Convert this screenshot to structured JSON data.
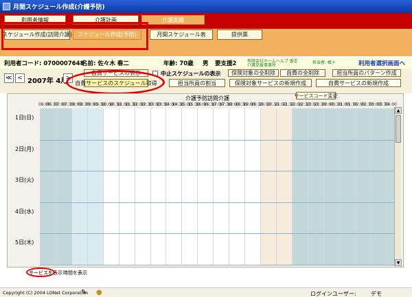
{
  "window": {
    "title": "月間スケジュール作成(介護予防)"
  },
  "top_tabs": [
    "利用者情報",
    "介護計画",
    "介護実績"
  ],
  "sub_tabs": [
    "スケジュール作成(訪問介護)",
    "スケジュール作成(予防)",
    "月間スケジュール表",
    "提供票"
  ],
  "info": {
    "user_code_label": "利用者コード: 0700007648",
    "name_label": "名前: 佐々木 春二",
    "age_label": "年齢: 70歳",
    "gender": "男",
    "care_level": "要支援2",
    "office_line1": "有限会社ホームヘルプ 香芝",
    "office_line2": "介護支援事業所",
    "staff": "担当者: 槙十",
    "select_user_link": "利用者選択画面へ"
  },
  "nav": {
    "prev_prev": "≪",
    "prev": "<",
    "month": "2007年 4月",
    "next": ">",
    "checkbox_label": "中止スケジュールの表示"
  },
  "action_buttons": {
    "row1": [
      "自費サービスの表示",
      "保険対象の全削除",
      "自費の全削除",
      "担当所員のパターン作成"
    ],
    "row2": [
      "自費サービスのスケジュール取得",
      "担当所員の割当",
      "保険対象サービスの新規作成",
      "自費サービスの新規作成"
    ]
  },
  "grid": {
    "title": "介護予防訪問介護",
    "service_code_button": "サービスコード変更",
    "times": [
      "06:00",
      "06:30",
      "07:00",
      "07:30",
      "08:00",
      "08:30",
      "09:00",
      "09:30",
      "10:00",
      "10:30",
      "11:00",
      "11:30",
      "12:00",
      "12:30",
      "13:00",
      "13:30",
      "14:00",
      "14:30",
      "15:00",
      "15:30",
      "16:00",
      "16:30",
      "17:00",
      "17:30",
      "18:00",
      "18:30",
      "19:00",
      "19:30",
      "20:00",
      "20:30",
      "21:00",
      "21:30",
      "22:00",
      "22:30",
      "23:00",
      "23:30",
      "00:00",
      "00:30",
      "01:00",
      "01:30",
      "02:00",
      "02:30",
      "03:00",
      "03:30",
      "04:00"
    ],
    "days": [
      "1日(日)",
      "2日(月)",
      "3日(火)",
      "4日(水)",
      "5日(木)"
    ],
    "colors": {
      "early": "#c3d9d9",
      "morning": "#dcebf2",
      "day": "#ffffff",
      "evening": "#f7ecdc",
      "night": "#c3d9d9"
    }
  },
  "footer": {
    "show_service": "サービスを表示",
    "show_time": "時間を表示",
    "copyright": "Copyright (C) 2004 LONet Corporation",
    "login_user_label": "ログインユーザー:",
    "login_user": "デモ"
  }
}
